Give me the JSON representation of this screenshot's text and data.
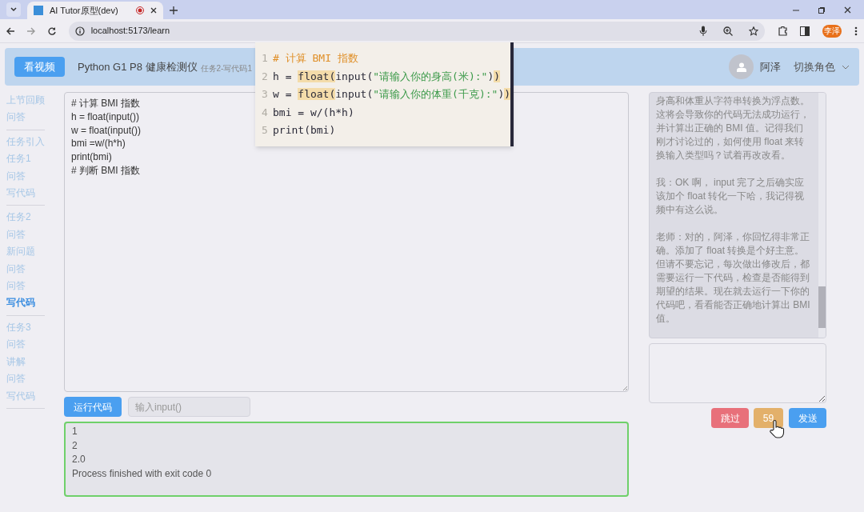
{
  "browser": {
    "tab_title": "AI Tutor原型(dev)",
    "url": "localhost:5173/learn",
    "profile_badge": "李泽"
  },
  "header": {
    "video_button": "看视频",
    "title": "Python G1 P8 健康检测仪",
    "subtitle": "任务2-写代码1",
    "user_name": "阿泽",
    "role_switch": "切换角色"
  },
  "sidebar": {
    "groups": [
      {
        "items": [
          {
            "label": "上节回顾",
            "selected": false
          },
          {
            "label": "问答",
            "selected": false
          }
        ]
      },
      {
        "items": [
          {
            "label": "任务引入",
            "selected": false
          },
          {
            "label": "任务1",
            "selected": false
          },
          {
            "label": "问答",
            "selected": false
          },
          {
            "label": "写代码",
            "selected": false
          }
        ]
      },
      {
        "items": [
          {
            "label": "任务2",
            "selected": false
          },
          {
            "label": "问答",
            "selected": false
          },
          {
            "label": "新问题",
            "selected": false
          },
          {
            "label": "问答",
            "selected": false
          },
          {
            "label": "问答",
            "selected": false
          },
          {
            "label": "写代码",
            "selected": true
          }
        ]
      },
      {
        "items": [
          {
            "label": "任务3",
            "selected": false
          },
          {
            "label": "问答",
            "selected": false
          },
          {
            "label": "讲解",
            "selected": false
          },
          {
            "label": "问答",
            "selected": false
          },
          {
            "label": "写代码",
            "selected": false
          }
        ]
      }
    ]
  },
  "editor": {
    "lines": [
      "# 计算 BMI 指数",
      "h = float(input())",
      "w = float(input())",
      "bmi =w/(h*h)",
      "print(bmi)",
      "# 判断 BMI 指数"
    ]
  },
  "run_button": "运行代码",
  "input_field": {
    "placeholder": "输入input()"
  },
  "output": {
    "lines": [
      "1",
      "2",
      "2.0",
      "Process finished with exit code 0"
    ]
  },
  "chat": {
    "messages": [
      "身高和体重从字符串转换为浮点数。这将会导致你的代码无法成功运行，并计算出正确的 BMI 值。记得我们刚才讨论过的，如何使用 float 来转换输入类型吗？试着再改改看。",
      "我：OK 啊， input 完了之后确实应该加个 float 转化一下哈，我记得视频中有这么说。",
      "老师：对的，阿泽，你回忆得非常正确。添加了 float 转换是个好主意。但请不要忘记，每次做出修改后，都需要运行一下代码，检查是否能得到期望的结果。现在就去运行一下你的代码吧，看看能否正确地计算出 BMI 值。"
    ]
  },
  "buttons": [
    {
      "label": "跳过",
      "kind": "skip"
    },
    {
      "label": "59",
      "kind": "timer"
    },
    {
      "label": "发送",
      "kind": "send"
    }
  ],
  "code_popup": {
    "lines": [
      {
        "number": "1",
        "segments": [
          {
            "text": "# 计算 BMI 指数",
            "kind": "comment"
          }
        ]
      },
      {
        "number": "2",
        "segments": [
          {
            "text": "h = ",
            "kind": "plain"
          },
          {
            "text": "float(",
            "kind": "highlight"
          },
          {
            "text": "input(",
            "kind": "plain"
          },
          {
            "text": "\"请输入你的身高(米):\"",
            "kind": "string"
          },
          {
            "text": ")",
            "kind": "plain"
          },
          {
            "text": ")",
            "kind": "highlight"
          }
        ]
      },
      {
        "number": "3",
        "segments": [
          {
            "text": "w = ",
            "kind": "plain"
          },
          {
            "text": "float(",
            "kind": "highlight"
          },
          {
            "text": "input(",
            "kind": "plain"
          },
          {
            "text": "\"请输入你的体重(千克):\"",
            "kind": "string"
          },
          {
            "text": ")",
            "kind": "plain"
          },
          {
            "text": ")",
            "kind": "highlight"
          }
        ]
      },
      {
        "number": "4",
        "segments": [
          {
            "text": "bmi = w/(h*h)",
            "kind": "plain"
          }
        ]
      },
      {
        "number": "5",
        "segments": [
          {
            "text": "print(bmi)",
            "kind": "plain"
          }
        ]
      }
    ]
  }
}
